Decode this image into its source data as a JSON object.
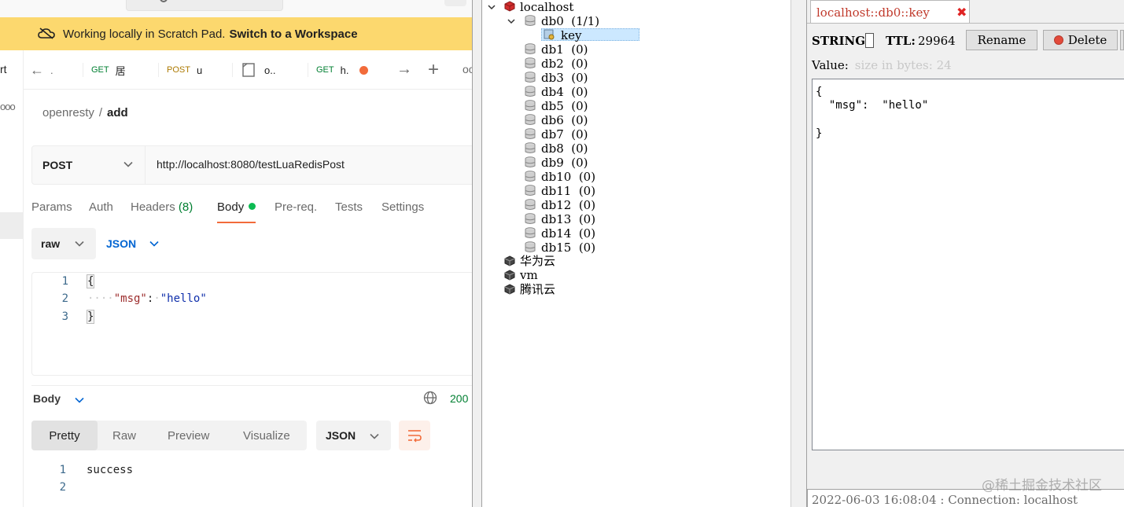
{
  "postman": {
    "banner": {
      "text": "Working locally in Scratch Pad.",
      "link": "Switch to a Workspace"
    },
    "sidebar": {
      "fragment": "rt",
      "more": "ooo"
    },
    "tabs": [
      {
        "method": "",
        "label": "← ."
      },
      {
        "method": "GET",
        "label": "居"
      },
      {
        "method": "POST",
        "label": "u"
      },
      {
        "method": "",
        "label": "o.."
      },
      {
        "method": "GET",
        "label": "h."
      }
    ],
    "breadcrumb": {
      "collection": "openresty",
      "separator": "/",
      "request": "add"
    },
    "request": {
      "method": "POST",
      "url": "http://localhost:8080/testLuaRedisPost"
    },
    "request_tabs": {
      "params": "Params",
      "auth": "Auth",
      "headers": "Headers",
      "headers_count": "(8)",
      "body": "Body",
      "prereq": "Pre-req.",
      "tests": "Tests",
      "settings": "Settings"
    },
    "body_mode": {
      "type": "raw",
      "format": "JSON"
    },
    "editor_lines": {
      "l1": {
        "num": "1",
        "text": "{"
      },
      "l2": {
        "num": "2",
        "indent": "····",
        "key": "\"msg\"",
        "colon": ":",
        "sp": "·",
        "value": "\"hello\""
      },
      "l3": {
        "num": "3",
        "text": "}"
      }
    },
    "response": {
      "label": "Body",
      "status": "200",
      "tabs": {
        "pretty": "Pretty",
        "raw": "Raw",
        "preview": "Preview",
        "visualize": "Visualize"
      },
      "format": "JSON",
      "lines": [
        {
          "num": "1",
          "text": "success"
        },
        {
          "num": "2",
          "text": ""
        }
      ]
    }
  },
  "tree": {
    "server": "localhost",
    "db0": "db0  (1/1)",
    "key": "key",
    "dbs": [
      "db1  (0)",
      "db2  (0)",
      "db3  (0)",
      "db4  (0)",
      "db5  (0)",
      "db6  (0)",
      "db7  (0)",
      "db8  (0)",
      "db9  (0)",
      "db10  (0)",
      "db11  (0)",
      "db12  (0)",
      "db13  (0)",
      "db14  (0)",
      "db15  (0)"
    ],
    "other_servers": [
      "华为云",
      "vm",
      "腾讯云"
    ]
  },
  "viewer": {
    "tab_title": "localhost::db0::key",
    "type_label": "STRING:",
    "ttl_label": "TTL:",
    "ttl_value": "29964",
    "rename": "Rename",
    "delete": "Delete",
    "value_label": "Value:",
    "size_hint": "size in bytes: 24",
    "value_lines": {
      "open": "{",
      "pair": "  \"msg\":  \"hello\"",
      "close": "}"
    },
    "status": "2022-06-03 16:08:04 : Connection: localhost"
  },
  "watermark": "@稀土掘金技术社区",
  "colors": {
    "banner": "#fcd86e",
    "accent": "#f26b3a",
    "link": "#0265d2",
    "get": "#007f31",
    "post": "#ad7a03",
    "selected": "#cce8ff"
  }
}
